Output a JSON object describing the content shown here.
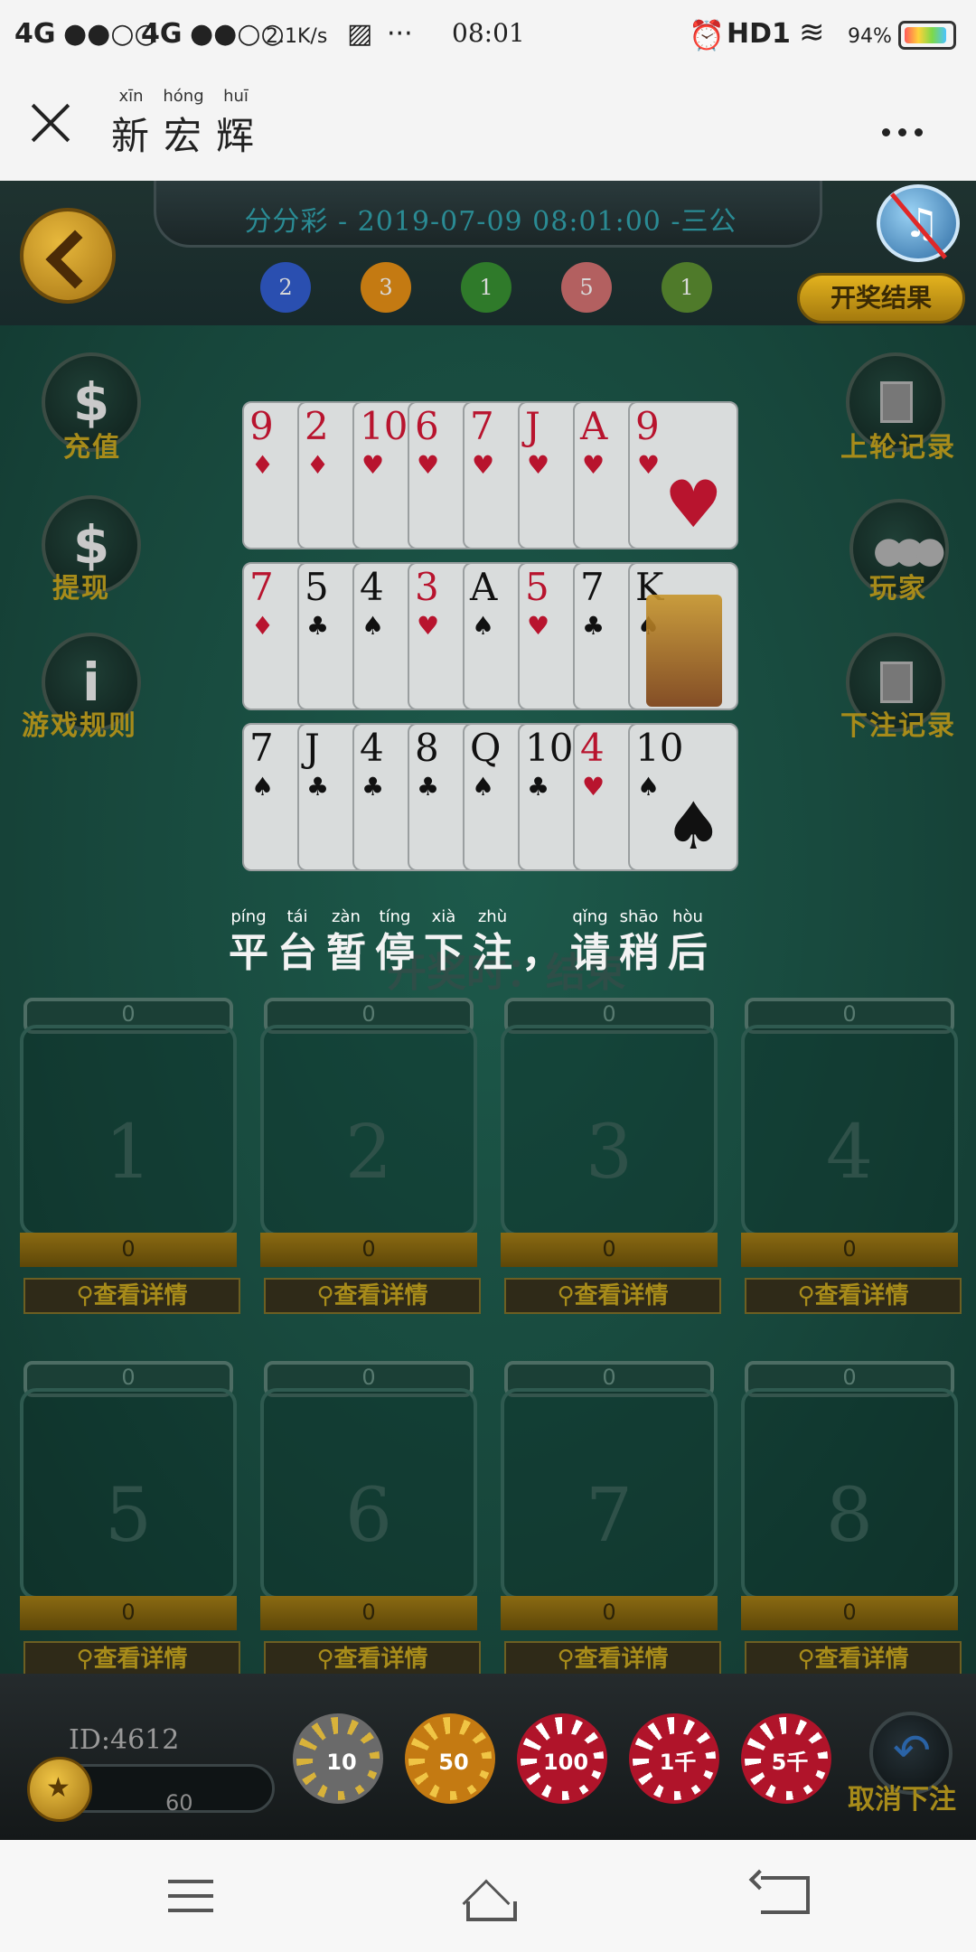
{
  "status_bar": {
    "network1": "4G",
    "signal1": "●●○○",
    "network2": "4G",
    "signal2": "●●○○",
    "speed": "2.1K/s",
    "more": "···",
    "time": "08:01",
    "hd": "HD1",
    "battery": "94%"
  },
  "title_bar": {
    "pinyin": [
      "xīn",
      "hóng",
      "huī"
    ],
    "chars": [
      "新",
      "宏",
      "辉"
    ]
  },
  "game": {
    "round_info": "分分彩 - 2019-07-09 08:01:00 -三公",
    "result_dots": [
      {
        "value": "2",
        "color": "#2a4fb0"
      },
      {
        "value": "3",
        "color": "#c47a12"
      },
      {
        "value": "1",
        "color": "#2f7a2a"
      },
      {
        "value": "5",
        "color": "#b36060"
      },
      {
        "value": "1",
        "color": "#4f7a2a"
      }
    ],
    "result_button": "开奖结果",
    "left_buttons": [
      {
        "label": "充值",
        "symbol": "$"
      },
      {
        "label": "提现",
        "symbol": "$"
      },
      {
        "label": "游戏规则",
        "symbol": "i"
      }
    ],
    "right_buttons": [
      {
        "label": "上轮记录"
      },
      {
        "label": "玩家"
      },
      {
        "label": "下注记录"
      }
    ],
    "card_rows": [
      [
        {
          "rank": "9",
          "suit": "♦"
        },
        {
          "rank": "2",
          "suit": "♦"
        },
        {
          "rank": "10",
          "suit": "♥"
        },
        {
          "rank": "6",
          "suit": "♥"
        },
        {
          "rank": "7",
          "suit": "♥"
        },
        {
          "rank": "J",
          "suit": "♥"
        },
        {
          "rank": "A",
          "suit": "♥"
        },
        {
          "rank": "9",
          "suit": "♥"
        }
      ],
      [
        {
          "rank": "7",
          "suit": "♦"
        },
        {
          "rank": "5",
          "suit": "♣"
        },
        {
          "rank": "4",
          "suit": "♠"
        },
        {
          "rank": "3",
          "suit": "♥"
        },
        {
          "rank": "A",
          "suit": "♠"
        },
        {
          "rank": "5",
          "suit": "♥"
        },
        {
          "rank": "7",
          "suit": "♣"
        },
        {
          "rank": "K",
          "suit": "♠"
        }
      ],
      [
        {
          "rank": "7",
          "suit": "♠"
        },
        {
          "rank": "J",
          "suit": "♣"
        },
        {
          "rank": "4",
          "suit": "♣"
        },
        {
          "rank": "8",
          "suit": "♣"
        },
        {
          "rank": "Q",
          "suit": "♠"
        },
        {
          "rank": "10",
          "suit": "♣"
        },
        {
          "rank": "4",
          "suit": "♥"
        },
        {
          "rank": "10",
          "suit": "♠"
        }
      ]
    ],
    "pause_pinyin": [
      "píng",
      "tái",
      "zàn",
      "tíng",
      "xià",
      "zhù",
      "",
      "qǐng",
      "shāo",
      "hòu"
    ],
    "pause_chars": [
      "平",
      "台",
      "暂",
      "停",
      "下",
      "注",
      "，",
      "请",
      "稍",
      "后"
    ],
    "pause_ghost": "开奖时：结束",
    "bet_boxes": [
      {
        "num": "1",
        "top": "0",
        "bottom": "0",
        "detail": "查看详情"
      },
      {
        "num": "2",
        "top": "0",
        "bottom": "0",
        "detail": "查看详情"
      },
      {
        "num": "3",
        "top": "0",
        "bottom": "0",
        "detail": "查看详情"
      },
      {
        "num": "4",
        "top": "0",
        "bottom": "0",
        "detail": "查看详情"
      },
      {
        "num": "5",
        "top": "0",
        "bottom": "0",
        "detail": "查看详情"
      },
      {
        "num": "6",
        "top": "0",
        "bottom": "0",
        "detail": "查看详情"
      },
      {
        "num": "7",
        "top": "0",
        "bottom": "0",
        "detail": "查看详情"
      },
      {
        "num": "8",
        "top": "0",
        "bottom": "0",
        "detail": "查看详情"
      }
    ],
    "user_id": "ID:4612",
    "balance": "60",
    "chips": [
      {
        "value": "10",
        "color": "#6a6a6a",
        "ring": "#d8b23a"
      },
      {
        "value": "50",
        "color": "#c47a12",
        "ring": "#f0c545"
      },
      {
        "value": "100",
        "color": "#b0142a",
        "ring": "#ffffff"
      },
      {
        "value": "1千",
        "color": "#b0142a",
        "ring": "#ffffff"
      },
      {
        "value": "5千",
        "color": "#b0142a",
        "ring": "#ffffff"
      }
    ],
    "cancel_bet": "取消下注"
  }
}
